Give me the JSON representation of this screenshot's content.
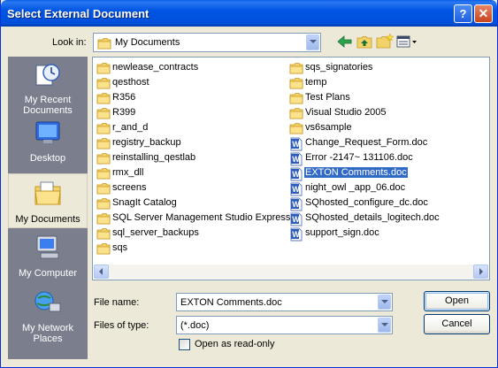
{
  "window": {
    "title": "Select External Document",
    "help_glyph": "?",
    "close_glyph": "✕"
  },
  "look_in": {
    "label": "Look in:",
    "value": "My Documents"
  },
  "places": [
    {
      "label": "My Recent Documents",
      "icon": "recent-documents-icon"
    },
    {
      "label": "Desktop",
      "icon": "desktop-icon"
    },
    {
      "label": "My Documents",
      "icon": "my-documents-icon",
      "active": true
    },
    {
      "label": "My Computer",
      "icon": "my-computer-icon"
    },
    {
      "label": "My Network Places",
      "icon": "network-places-icon"
    }
  ],
  "files": {
    "column1": [
      {
        "name": "newlease_contracts",
        "type": "folder"
      },
      {
        "name": "qesthost",
        "type": "folder"
      },
      {
        "name": "R356",
        "type": "folder"
      },
      {
        "name": "R399",
        "type": "folder"
      },
      {
        "name": "r_and_d",
        "type": "folder"
      },
      {
        "name": "registry_backup",
        "type": "folder"
      },
      {
        "name": "reinstalling_qestlab",
        "type": "folder"
      },
      {
        "name": "rmx_dll",
        "type": "folder"
      },
      {
        "name": "screens",
        "type": "folder"
      },
      {
        "name": "SnagIt Catalog",
        "type": "folder"
      },
      {
        "name": "SQL Server Management Studio Express",
        "type": "folder"
      },
      {
        "name": "sql_server_backups",
        "type": "folder"
      },
      {
        "name": "sqs",
        "type": "folder"
      }
    ],
    "column2": [
      {
        "name": "sqs_signatories",
        "type": "folder"
      },
      {
        "name": "temp",
        "type": "folder"
      },
      {
        "name": "Test Plans",
        "type": "folder"
      },
      {
        "name": "Visual Studio 2005",
        "type": "folder"
      },
      {
        "name": "vs6sample",
        "type": "folder"
      },
      {
        "name": "Change_Request_Form.doc",
        "type": "doc"
      },
      {
        "name": "Error -2147~ 131106.doc",
        "type": "doc"
      },
      {
        "name": "EXTON Comments.doc",
        "type": "doc",
        "selected": true
      },
      {
        "name": "night_owl _app_06.doc",
        "type": "doc"
      },
      {
        "name": "SQhosted_configure_dc.doc",
        "type": "doc"
      },
      {
        "name": "SQhosted_details_logitech.doc",
        "type": "doc"
      },
      {
        "name": "support_sign.doc",
        "type": "doc"
      }
    ]
  },
  "file_name": {
    "label": "File name:",
    "value": "EXTON Comments.doc"
  },
  "file_type": {
    "label": "Files of type:",
    "value": "(*.doc)"
  },
  "read_only": {
    "label": "Open as read-only",
    "checked": false
  },
  "buttons": {
    "open": "Open",
    "cancel": "Cancel"
  },
  "colors": {
    "titlebar": "#0054e3",
    "selection": "#316ac5",
    "places_bar": "#7b7f8d",
    "dialog_bg": "#ece9d8"
  }
}
